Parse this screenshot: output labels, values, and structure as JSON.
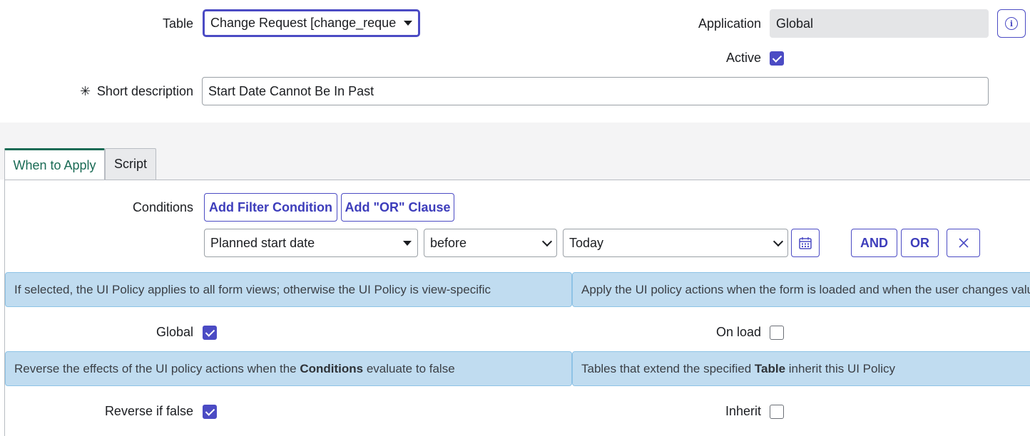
{
  "form": {
    "table_label": "Table",
    "table_value": "Change Request [change_request]",
    "application_label": "Application",
    "application_value": "Global",
    "active_label": "Active",
    "active_checked": true,
    "required_marker": "✳",
    "short_description_label": "Short description",
    "short_description_value": "Start Date Cannot Be In Past"
  },
  "tabs": [
    {
      "label": "When to Apply",
      "active": true
    },
    {
      "label": "Script",
      "active": false
    }
  ],
  "conditions": {
    "label": "Conditions",
    "add_filter_label": "Add Filter Condition",
    "add_or_label": "Add \"OR\" Clause",
    "field_value": "Planned start date",
    "operator_value": "before",
    "value_value": "Today",
    "and_label": "AND",
    "or_label": "OR"
  },
  "hints": {
    "global": "If selected, the UI Policy applies to all form views; otherwise the UI Policy is view-specific",
    "on_load": "Apply the UI policy actions when the form is loaded and when the user changes values on the form",
    "reverse_pre": "Reverse the effects of the UI policy actions when the ",
    "reverse_bold": "Conditions",
    "reverse_post": " evaluate to false",
    "inherit_pre": "Tables that extend the specified ",
    "inherit_bold": "Table",
    "inherit_post": " inherit this UI Policy"
  },
  "options": {
    "global_label": "Global",
    "global_checked": true,
    "on_load_label": "On load",
    "on_load_checked": false,
    "reverse_label": "Reverse if false",
    "reverse_checked": true,
    "inherit_label": "Inherit",
    "inherit_checked": false
  },
  "colors": {
    "accent": "#4b4bc4",
    "tab_active": "#1a6b55",
    "hint_bg": "#c0dcf0"
  }
}
